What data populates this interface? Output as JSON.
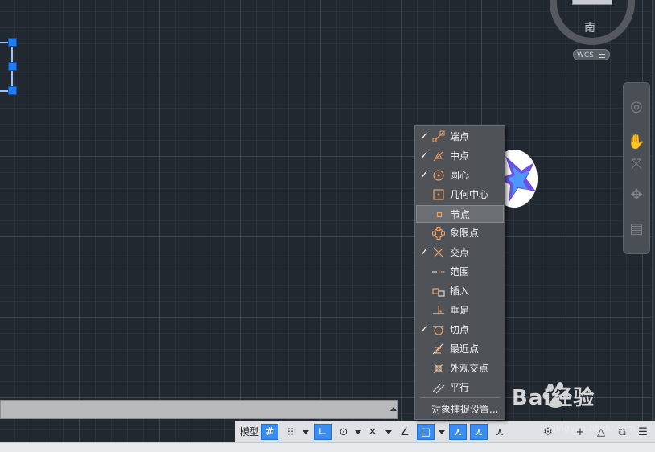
{
  "viewcube": {
    "compass_label": "南",
    "wcs_label": "WCS"
  },
  "snap_menu": {
    "items": [
      {
        "label": "端点",
        "checked": true,
        "icon": "endpoint-icon"
      },
      {
        "label": "中点",
        "checked": true,
        "icon": "midpoint-icon"
      },
      {
        "label": "圆心",
        "checked": true,
        "icon": "center-icon"
      },
      {
        "label": "几何中心",
        "checked": false,
        "icon": "geometric-center-icon"
      },
      {
        "label": "节点",
        "checked": false,
        "icon": "node-icon",
        "highlighted": true
      },
      {
        "label": "象限点",
        "checked": false,
        "icon": "quadrant-icon"
      },
      {
        "label": "交点",
        "checked": true,
        "icon": "intersection-icon"
      },
      {
        "label": "范围",
        "checked": false,
        "icon": "extension-icon"
      },
      {
        "label": "插入",
        "checked": false,
        "icon": "insertion-icon"
      },
      {
        "label": "垂足",
        "checked": false,
        "icon": "perpendicular-icon"
      },
      {
        "label": "切点",
        "checked": true,
        "icon": "tangent-icon"
      },
      {
        "label": "最近点",
        "checked": false,
        "icon": "nearest-icon"
      },
      {
        "label": "外观交点",
        "checked": false,
        "icon": "apparent-intersection-icon"
      },
      {
        "label": "平行",
        "checked": false,
        "icon": "parallel-icon"
      }
    ],
    "settings_label": "对象捕捉设置...",
    "check_glyph": "✓"
  },
  "statusbar": {
    "model_label": "模型"
  },
  "watermark": {
    "brand": "Bai经验",
    "url": "jingyan.baidu.com"
  },
  "colors": {
    "menu_bg": "#4f5257",
    "accent_blue": "#3c8df0",
    "snap_icon": "#f0a060"
  }
}
